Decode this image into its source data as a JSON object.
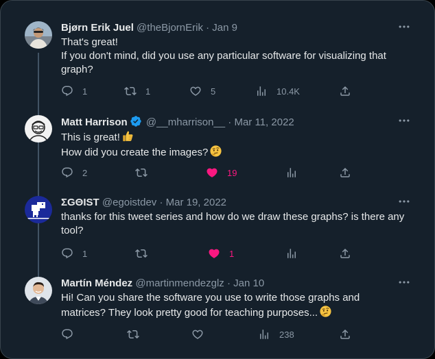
{
  "colors": {
    "background": "#15202b",
    "text": "#e7e9ea",
    "muted": "#8b98a5",
    "like_active": "#f91880",
    "verified": "#1d9bf0",
    "thread_line": "#425364"
  },
  "tweets": [
    {
      "name": "Bjørn Erik Juel",
      "handle_date": "@theBjornErik · Jan 9",
      "lines": [
        "That's great!",
        "If you don't mind, did you use any particular software for visualizing that graph?"
      ],
      "replies": "1",
      "retweets": "1",
      "likes": "5",
      "views": "10.4K",
      "liked": false
    },
    {
      "name": "Matt Harrison",
      "verified": true,
      "handle_date": "@__mharrison__ · Mar 11, 2022",
      "lines": [
        "This is great!",
        "How did you create the images?"
      ],
      "emojis": [
        "thumbs-up",
        "thinking-face"
      ],
      "replies": "2",
      "retweets": "",
      "likes": "19",
      "views": "",
      "liked": true
    },
    {
      "name": "ΣGΘIST",
      "handle_date": "@egoistdev · Mar 19, 2022",
      "lines": [
        "thanks for this tweet series and how do we draw these graphs? is there any tool?"
      ],
      "replies": "1",
      "retweets": "",
      "likes": "1",
      "views": "",
      "liked": true
    },
    {
      "name": "Martín Méndez",
      "handle_date": "@martinmendezglz · Jan 10",
      "lines": [
        "Hi! Can you share the software you use to write those graphs and matrices? They look pretty good for teaching purposes..."
      ],
      "emojis": [
        "thinking-face"
      ],
      "replies": "",
      "retweets": "",
      "likes": "",
      "views": "238",
      "liked": false
    }
  ]
}
